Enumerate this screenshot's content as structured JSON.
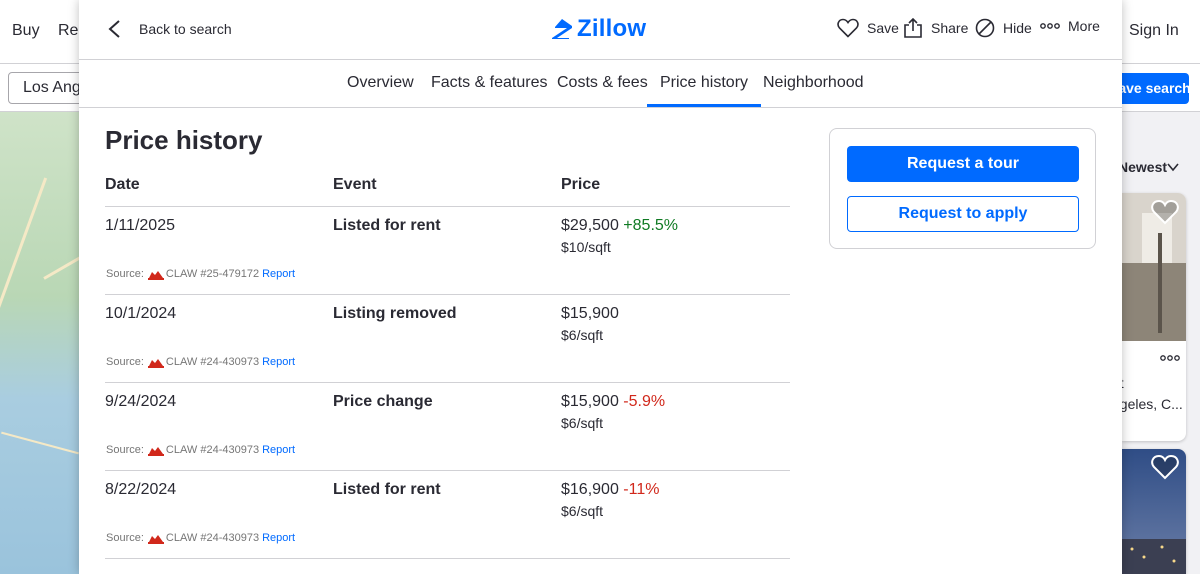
{
  "background": {
    "nav": [
      "Buy",
      "Ren"
    ],
    "sign_in": "Sign In",
    "search_value": "Los Angeles",
    "save_search": "Save search",
    "sort_label": "Newest",
    "card_text_line1": "nt",
    "card_text_line2": "ngeles, C..."
  },
  "modal": {
    "back_label": "Back to search",
    "logo_text": "Zillow",
    "actions": {
      "save": "Save",
      "share": "Share",
      "hide": "Hide",
      "more": "More"
    },
    "tabs": [
      {
        "label": "Overview",
        "active": false
      },
      {
        "label": "Facts & features",
        "active": false
      },
      {
        "label": "Costs & fees",
        "active": false
      },
      {
        "label": "Price history",
        "active": true
      },
      {
        "label": "Neighborhood",
        "active": false
      }
    ],
    "section_title": "Price history",
    "columns": {
      "date": "Date",
      "event": "Event",
      "price": "Price"
    },
    "rows": [
      {
        "date": "1/11/2025",
        "event": "Listed for rent",
        "price": "$29,500",
        "change": "+85.5%",
        "change_dir": "up",
        "per_sqft": "$10/sqft",
        "source_label": "Source:",
        "source_name": "CLAW",
        "source_id": "#25-479172",
        "report": "Report"
      },
      {
        "date": "10/1/2024",
        "event": "Listing removed",
        "price": "$15,900",
        "change": "",
        "change_dir": "none",
        "per_sqft": "$6/sqft",
        "source_label": "Source:",
        "source_name": "CLAW",
        "source_id": "#24-430973",
        "report": "Report"
      },
      {
        "date": "9/24/2024",
        "event": "Price change",
        "price": "$15,900",
        "change": "-5.9%",
        "change_dir": "down",
        "per_sqft": "$6/sqft",
        "source_label": "Source:",
        "source_name": "CLAW",
        "source_id": "#24-430973",
        "report": "Report"
      },
      {
        "date": "8/22/2024",
        "event": "Listed for rent",
        "price": "$16,900",
        "change": "-11%",
        "change_dir": "down",
        "per_sqft": "$6/sqft",
        "source_label": "Source:",
        "source_name": "CLAW",
        "source_id": "#24-430973",
        "report": "Report"
      }
    ],
    "side_card": {
      "request_tour": "Request a tour",
      "request_apply": "Request to apply"
    }
  },
  "colors": {
    "accent": "#006aff",
    "positive": "#0f7a23",
    "negative": "#d1281b",
    "text": "#2a2a33",
    "divider": "#d1d1d5"
  },
  "icons": [
    "chevron-left-icon",
    "zillow-logo-icon",
    "heart-icon",
    "share-icon",
    "hide-icon",
    "more-dots-icon",
    "claw-logo-icon",
    "chevron-down-icon"
  ]
}
